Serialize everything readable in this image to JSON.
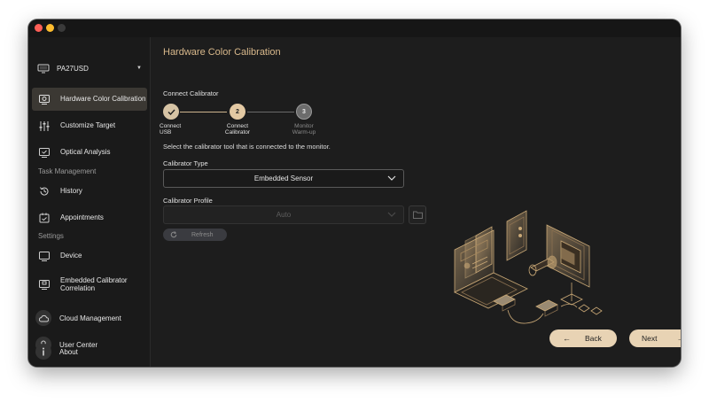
{
  "window": {
    "traffic_lights": [
      "#ff5f57",
      "#febc2e",
      "#3a3a3a"
    ]
  },
  "sidebar": {
    "device": {
      "label": "PA27USD",
      "icon": "monitor-icon"
    },
    "items": [
      {
        "label": "Hardware Color Calibration",
        "icon": "calibration-monitor-icon",
        "active": true
      },
      {
        "label": "Customize Target",
        "icon": "sliders-icon"
      },
      {
        "label": "Optical Analysis",
        "icon": "monitor-check-icon"
      }
    ],
    "task_management": {
      "heading": "Task Management",
      "items": [
        {
          "label": "History",
          "icon": "history-icon"
        },
        {
          "label": "Appointments",
          "icon": "calendar-check-icon"
        }
      ]
    },
    "settings": {
      "heading": "Settings",
      "items": [
        {
          "label": "Device",
          "icon": "monitor-icon"
        },
        {
          "label": "Embedded Calibrator Correlation",
          "icon": "calibrator-monitor-icon"
        }
      ]
    },
    "bottom": [
      {
        "label": "Cloud Management",
        "icon": "cloud-icon"
      },
      {
        "label": "User Center",
        "icon": "user-icon"
      },
      {
        "label": "About",
        "icon": "info-icon"
      }
    ]
  },
  "main": {
    "title": "Hardware Color Calibration",
    "section": "Connect Calibrator",
    "steps": [
      {
        "number": "",
        "label_line1": "Connect",
        "label_line2": "USB",
        "state": "done"
      },
      {
        "number": "2",
        "label_line1": "Connect",
        "label_line2": "Calibrator",
        "state": "current"
      },
      {
        "number": "3",
        "label_line1": "Monitor",
        "label_line2": "Warm-up",
        "state": "pending"
      }
    ],
    "instruction": "Select the calibrator tool that is connected to the monitor.",
    "calibrator_type": {
      "label": "Calibrator Type",
      "value": "Embedded Sensor"
    },
    "calibrator_profile": {
      "label": "Calibrator Profile",
      "value": "Auto",
      "disabled": true
    },
    "refresh_label": "Refresh",
    "back_label": "Back",
    "next_label": "Next",
    "accent": "#d9b98c",
    "button_color": "#e8d3b4"
  }
}
